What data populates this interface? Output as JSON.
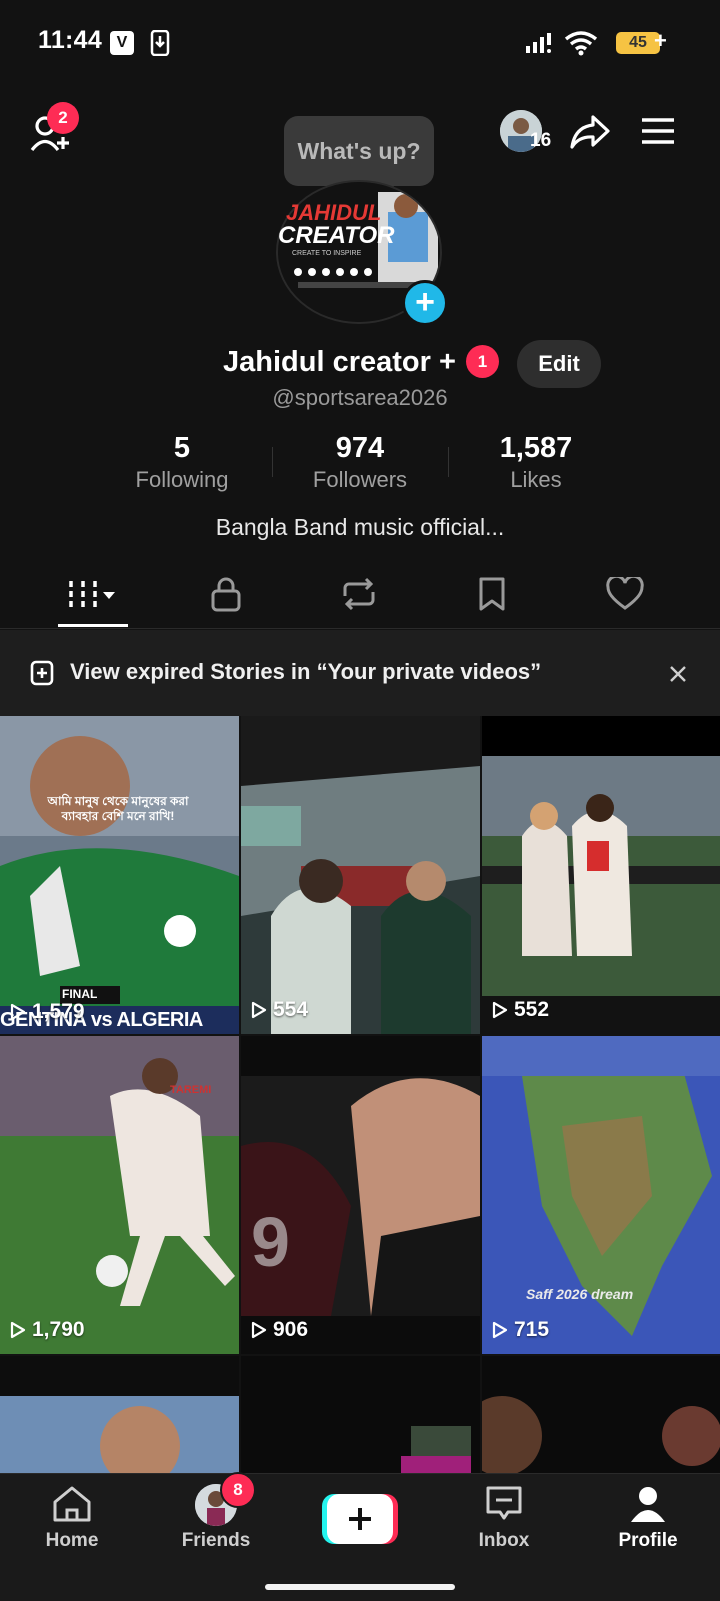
{
  "status_bar": {
    "time": "11:44",
    "battery": "45",
    "battery_suffix": "+",
    "badge_v": "V"
  },
  "header": {
    "add_friends_badge": "2",
    "story_bubble": "What's up?",
    "friends_viewed_count": "16"
  },
  "profile": {
    "name": "Jahidul creator +",
    "name_badge": "1",
    "edit_label": "Edit",
    "handle": "@sportsarea2026",
    "avatar_text_line1": "JAHIDUL",
    "avatar_text_line2": "CREATOR",
    "avatar_subtext": "CREATE TO INSPIRE",
    "stats": [
      {
        "value": "5",
        "label": "Following"
      },
      {
        "value": "974",
        "label": "Followers"
      },
      {
        "value": "1,587",
        "label": "Likes"
      }
    ],
    "bio": "Bangla Band music official..."
  },
  "tabs": [
    {
      "name": "videos",
      "icon": "grid-icon"
    },
    {
      "name": "private",
      "icon": "lock-icon"
    },
    {
      "name": "reposts",
      "icon": "repost-icon"
    },
    {
      "name": "favorites",
      "icon": "bookmark-icon"
    },
    {
      "name": "liked",
      "icon": "heart-icon"
    }
  ],
  "banner": {
    "text": "View expired Stories in “Your private videos”"
  },
  "videos": [
    {
      "views": "1,579",
      "overlay_top": "আমি মানুষ থেকে মানুষের করা ব্যাবহার বেশি মনে রাখি!",
      "overlay_bottom": "GENTINA vs ALGERIA",
      "tag": "FINAL"
    },
    {
      "views": "554"
    },
    {
      "views": "552"
    },
    {
      "views": "1,790",
      "tag": "TAREMI"
    },
    {
      "views": "906"
    },
    {
      "views": "715",
      "overlay_bottom": "Saff 2026 dream"
    },
    {
      "views": ""
    },
    {
      "views": ""
    },
    {
      "views": ""
    }
  ],
  "bottom_nav": {
    "home": "Home",
    "friends": "Friends",
    "friends_badge": "8",
    "inbox": "Inbox",
    "profile": "Profile"
  }
}
